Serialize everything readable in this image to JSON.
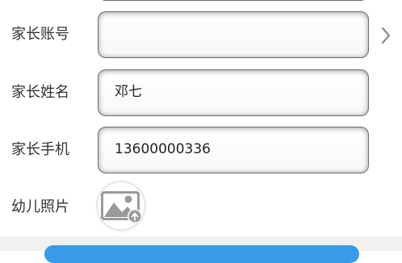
{
  "form": {
    "parent_account": {
      "label": "家长账号",
      "value": ""
    },
    "parent_name": {
      "label": "家长姓名",
      "value": "邓七"
    },
    "parent_phone": {
      "label": "家长手机",
      "value": "13600000336"
    },
    "child_photo": {
      "label": "幼儿照片",
      "icon": "image-upload-icon"
    },
    "account_chevron_icon": "chevron-right-icon"
  },
  "colors": {
    "label_text": "#333333",
    "field_border": "#6e6e6e",
    "chevron": "#8a8a8a",
    "submit_button": "#3a9ae8",
    "photo_icon": "#9a9a9a"
  }
}
